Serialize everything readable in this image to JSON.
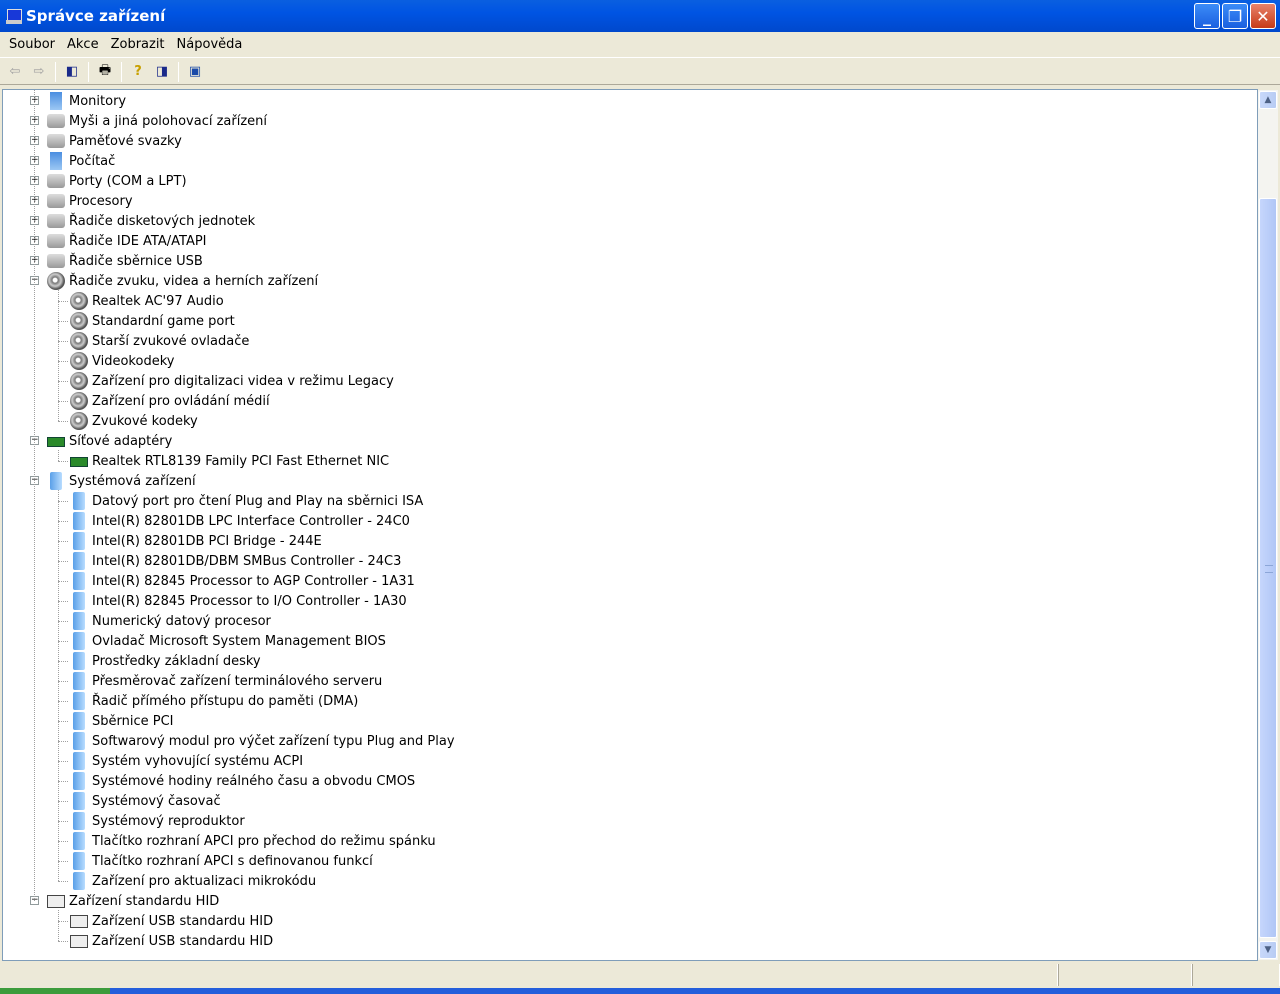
{
  "window": {
    "title": "Správce zařízení"
  },
  "menu": [
    {
      "label": "Soubor"
    },
    {
      "label": "Akce"
    },
    {
      "label": "Zobrazit"
    },
    {
      "label": "Nápověda"
    }
  ],
  "toolbar": [
    "back-icon",
    "forward-icon",
    "show-hide-tree-icon",
    "print-icon",
    "help-icon",
    "properties-icon",
    "scan-hardware-icon"
  ],
  "tree": [
    {
      "label": "Monitory",
      "level": 1,
      "exp": "+",
      "icon": "mon"
    },
    {
      "label": "Myši a jiná polohovací zařízení",
      "level": 1,
      "exp": "+",
      "icon": "gen"
    },
    {
      "label": "Paměťové svazky",
      "level": 1,
      "exp": "+",
      "icon": "gen"
    },
    {
      "label": "Počítač",
      "level": 1,
      "exp": "+",
      "icon": "mon"
    },
    {
      "label": "Porty (COM a LPT)",
      "level": 1,
      "exp": "+",
      "icon": "gen"
    },
    {
      "label": "Procesory",
      "level": 1,
      "exp": "+",
      "icon": "gen"
    },
    {
      "label": "Řadiče disketových jednotek",
      "level": 1,
      "exp": "+",
      "icon": "gen"
    },
    {
      "label": "Řadiče IDE ATA/ATAPI",
      "level": 1,
      "exp": "+",
      "icon": "gen"
    },
    {
      "label": "Řadiče sběrnice USB",
      "level": 1,
      "exp": "+",
      "icon": "gen"
    },
    {
      "label": "Řadiče zvuku, videa a herních zařízení",
      "level": 1,
      "exp": "-",
      "icon": "snd"
    },
    {
      "label": "Realtek AC'97 Audio",
      "level": 2,
      "icon": "snd"
    },
    {
      "label": "Standardní game port",
      "level": 2,
      "icon": "snd"
    },
    {
      "label": "Starší zvukové ovladače",
      "level": 2,
      "icon": "snd"
    },
    {
      "label": "Videokodeky",
      "level": 2,
      "icon": "snd"
    },
    {
      "label": "Zařízení pro digitalizaci videa v režimu Legacy",
      "level": 2,
      "icon": "snd"
    },
    {
      "label": "Zařízení pro ovládání médií",
      "level": 2,
      "icon": "snd"
    },
    {
      "label": "Zvukové kodeky",
      "level": 2,
      "icon": "snd"
    },
    {
      "label": "Síťové adaptéry",
      "level": 1,
      "exp": "-",
      "icon": "net"
    },
    {
      "label": "Realtek RTL8139 Family PCI Fast Ethernet NIC",
      "level": 2,
      "icon": "net"
    },
    {
      "label": "Systémová zařízení",
      "level": 1,
      "exp": "-",
      "icon": "sys"
    },
    {
      "label": "Datový port pro čtení Plug and Play na sběrnici ISA",
      "level": 2,
      "icon": "sys"
    },
    {
      "label": "Intel(R) 82801DB LPC Interface Controller - 24C0",
      "level": 2,
      "icon": "sys"
    },
    {
      "label": "Intel(R) 82801DB PCI Bridge - 244E",
      "level": 2,
      "icon": "sys"
    },
    {
      "label": "Intel(R) 82801DB/DBM SMBus Controller - 24C3",
      "level": 2,
      "icon": "sys"
    },
    {
      "label": "Intel(R) 82845 Processor to AGP Controller - 1A31",
      "level": 2,
      "icon": "sys"
    },
    {
      "label": "Intel(R) 82845 Processor to I/O Controller - 1A30",
      "level": 2,
      "icon": "sys"
    },
    {
      "label": "Numerický datový procesor",
      "level": 2,
      "icon": "sys"
    },
    {
      "label": "Ovladač Microsoft System Management BIOS",
      "level": 2,
      "icon": "sys"
    },
    {
      "label": "Prostředky základní desky",
      "level": 2,
      "icon": "sys"
    },
    {
      "label": "Přesměrovač zařízení terminálového serveru",
      "level": 2,
      "icon": "sys"
    },
    {
      "label": "Řadič přímého přístupu do paměti (DMA)",
      "level": 2,
      "icon": "sys"
    },
    {
      "label": "Sběrnice PCI",
      "level": 2,
      "icon": "sys"
    },
    {
      "label": "Softwarový modul pro výčet zařízení typu Plug and Play",
      "level": 2,
      "icon": "sys"
    },
    {
      "label": "Systém vyhovující systému ACPI",
      "level": 2,
      "icon": "sys"
    },
    {
      "label": "Systémové hodiny reálného času a obvodu CMOS",
      "level": 2,
      "icon": "sys"
    },
    {
      "label": "Systémový časovač",
      "level": 2,
      "icon": "sys"
    },
    {
      "label": "Systémový reproduktor",
      "level": 2,
      "icon": "sys"
    },
    {
      "label": "Tlačítko rozhraní APCI pro přechod do režimu spánku",
      "level": 2,
      "icon": "sys"
    },
    {
      "label": "Tlačítko rozhraní APCI s definovanou funkcí",
      "level": 2,
      "icon": "sys"
    },
    {
      "label": "Zařízení pro aktualizaci mikrokódu",
      "level": 2,
      "icon": "sys"
    },
    {
      "label": "Zařízení standardu HID",
      "level": 1,
      "exp": "-",
      "icon": "hid"
    },
    {
      "label": "Zařízení USB standardu HID",
      "level": 2,
      "icon": "hid"
    },
    {
      "label": "Zařízení USB standardu HID",
      "level": 2,
      "icon": "hid"
    }
  ],
  "scroll": {
    "position_fraction": 0.12
  }
}
